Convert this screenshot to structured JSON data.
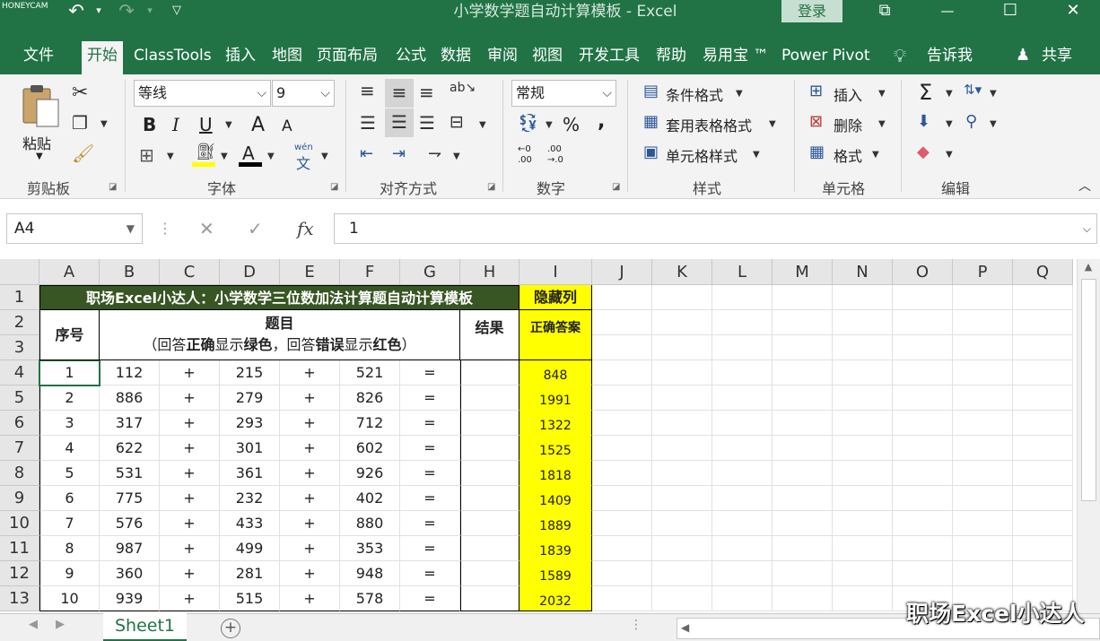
{
  "titlebar": {
    "watermark": "HONEYCAM",
    "title": "小学数学题自动计算模板  -  Excel",
    "login": "登录",
    "undo_icon": "↶",
    "redo_icon": "↷",
    "qa_arrow": "▾",
    "customize_icon": "▽",
    "restore_icon": "⧉",
    "minimize_icon": "—",
    "maximize_icon": "☐",
    "close_icon": "✕"
  },
  "tabs": [
    {
      "label": "文件"
    },
    {
      "label": "开始"
    },
    {
      "label": "ClassTools"
    },
    {
      "label": "插入"
    },
    {
      "label": "地图"
    },
    {
      "label": "页面布局"
    },
    {
      "label": "公式"
    },
    {
      "label": "数据"
    },
    {
      "label": "审阅"
    },
    {
      "label": "视图"
    },
    {
      "label": "开发工具"
    },
    {
      "label": "帮助"
    },
    {
      "label": "易用宝 ™"
    },
    {
      "label": "Power Pivot"
    }
  ],
  "tell_me": "告诉我",
  "share": "共享",
  "ribbon": {
    "clipboard": {
      "paste": "粘贴",
      "label": "剪贴板"
    },
    "font": {
      "name": "等线",
      "size": "9",
      "bold": "B",
      "italic": "I",
      "underline": "U",
      "grow": "A",
      "shrink": "A",
      "font_color": "A",
      "phonetic_top": "wén",
      "phonetic_bottom": "文",
      "label": "字体"
    },
    "alignment": {
      "label": "对齐方式"
    },
    "number": {
      "format": "常规",
      "percent": "%",
      "comma": ",",
      "inc_top": "←0",
      "inc_bottom": ".00",
      "dec_top": ".00",
      "dec_bottom": "→.0",
      "label": "数字"
    },
    "styles": {
      "conditional": "条件格式",
      "table": "套用表格格式",
      "cell_styles": "单元格样式",
      "label": "样式"
    },
    "cells": {
      "insert": "插入",
      "delete": "删除",
      "format": "格式",
      "label": "单元格"
    },
    "editing": {
      "sum": "Σ",
      "label": "编辑"
    }
  },
  "formula_bar": {
    "name_box": "A4",
    "cancel_icon": "✕",
    "enter_icon": "✓",
    "fx_icon": "fx",
    "value": "1"
  },
  "columns": [
    "A",
    "B",
    "C",
    "D",
    "E",
    "F",
    "G",
    "H",
    "I",
    "J",
    "K",
    "L",
    "M",
    "N",
    "O",
    "P",
    "Q"
  ],
  "rows": [
    "1",
    "2",
    "3",
    "4",
    "5",
    "6",
    "7",
    "8",
    "9",
    "10",
    "11",
    "12",
    "13"
  ],
  "sheet": {
    "title": "职场Excel小达人：小学数学三位数加法计算题自动计算模板",
    "hidden_col_header": "隐藏列",
    "seq_header": "序号",
    "question_header": "题目",
    "question_hint": {
      "p1": "（回答",
      "p2": "正确",
      "p3": "显示",
      "p4": "绿色",
      "p5": "，回答",
      "p6": "错误",
      "p7": "显示",
      "p8": "红色",
      "p9": "）"
    },
    "result_header": "结果",
    "answer_header": "正确答案",
    "problems": [
      {
        "seq": "1",
        "a": "112",
        "op1": "+",
        "b": "215",
        "op2": "+",
        "c": "521",
        "eq": "=",
        "answer": "848"
      },
      {
        "seq": "2",
        "a": "886",
        "op1": "+",
        "b": "279",
        "op2": "+",
        "c": "826",
        "eq": "=",
        "answer": "1991"
      },
      {
        "seq": "3",
        "a": "317",
        "op1": "+",
        "b": "293",
        "op2": "+",
        "c": "712",
        "eq": "=",
        "answer": "1322"
      },
      {
        "seq": "4",
        "a": "622",
        "op1": "+",
        "b": "301",
        "op2": "+",
        "c": "602",
        "eq": "=",
        "answer": "1525"
      },
      {
        "seq": "5",
        "a": "531",
        "op1": "+",
        "b": "361",
        "op2": "+",
        "c": "926",
        "eq": "=",
        "answer": "1818"
      },
      {
        "seq": "6",
        "a": "775",
        "op1": "+",
        "b": "232",
        "op2": "+",
        "c": "402",
        "eq": "=",
        "answer": "1409"
      },
      {
        "seq": "7",
        "a": "576",
        "op1": "+",
        "b": "433",
        "op2": "+",
        "c": "880",
        "eq": "=",
        "answer": "1889"
      },
      {
        "seq": "8",
        "a": "987",
        "op1": "+",
        "b": "499",
        "op2": "+",
        "c": "353",
        "eq": "=",
        "answer": "1839"
      },
      {
        "seq": "9",
        "a": "360",
        "op1": "+",
        "b": "281",
        "op2": "+",
        "c": "948",
        "eq": "=",
        "answer": "1589"
      },
      {
        "seq": "10",
        "a": "939",
        "op1": "+",
        "b": "515",
        "op2": "+",
        "c": "578",
        "eq": "=",
        "answer": "2032"
      }
    ]
  },
  "sheet_tabs": {
    "active": "Sheet1",
    "add": "+"
  },
  "brand_watermark": "职场Excel小达人",
  "colors": {
    "excel_green": "#217346",
    "title_fill": "#375623",
    "highlight": "#ffff00"
  }
}
